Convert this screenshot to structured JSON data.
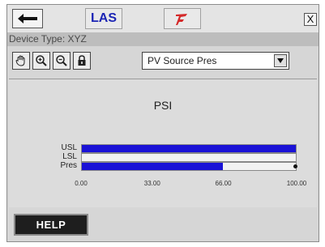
{
  "header": {
    "back_icon": "arrow-left-icon",
    "las_label": "LAS",
    "hart_icon": "hart-logo-icon",
    "close_label": "X"
  },
  "device": {
    "type_text": "Device Type: XYZ"
  },
  "toolbar": {
    "tools": [
      "hand-pan-icon",
      "zoom-in-icon",
      "zoom-out-icon",
      "lock-icon"
    ],
    "select_value": "PV Source Pres"
  },
  "chart_data": {
    "type": "bar",
    "orientation": "horizontal",
    "title": "PSI",
    "categories": [
      "USL",
      "LSL",
      "Pres"
    ],
    "values": [
      100,
      0,
      66
    ],
    "marker_value": 100,
    "xticks": [
      "0.00",
      "33.00",
      "66.00",
      "100.00"
    ],
    "xlim": [
      0,
      100
    ],
    "colors": {
      "fill": "#1a12d6",
      "track": "#f2f2f2"
    }
  },
  "footer": {
    "help_label": "HELP"
  }
}
